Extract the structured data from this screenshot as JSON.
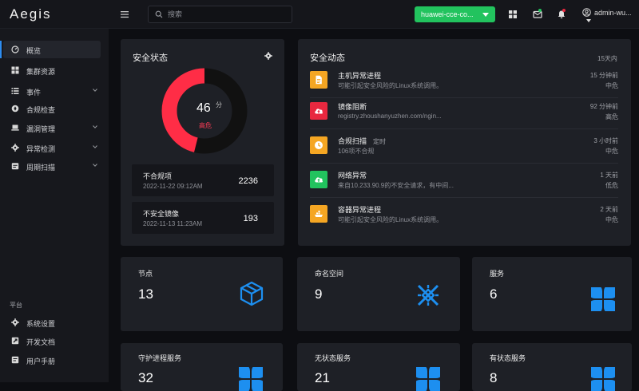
{
  "app": {
    "logo": "Aegis"
  },
  "header": {
    "search_placeholder": "搜索",
    "cluster_name": "huawei-cce-co...",
    "username": "admin-wu..."
  },
  "sidebar": {
    "items": [
      {
        "label": "概览",
        "icon": "dashboard-icon"
      },
      {
        "label": "集群资源",
        "icon": "grid-icon"
      },
      {
        "label": "事件",
        "icon": "list-icon"
      },
      {
        "label": "合规检查",
        "icon": "compass-icon"
      },
      {
        "label": "漏洞管理",
        "icon": "laptop-icon"
      },
      {
        "label": "异常检测",
        "icon": "gear-icon"
      },
      {
        "label": "周期扫描",
        "icon": "calendar-icon"
      }
    ],
    "section_label": "平台",
    "platform_items": [
      {
        "label": "系统设置",
        "icon": "settings-icon"
      },
      {
        "label": "开发文档",
        "icon": "link-icon"
      },
      {
        "label": "用户手册",
        "icon": "book-icon"
      }
    ]
  },
  "security_status": {
    "title": "安全状态",
    "score": "46",
    "score_unit": "分",
    "level": "高危",
    "score_fraction": 0.46,
    "colors": {
      "risk": "#ff2d46",
      "track": "#111111"
    },
    "items": [
      {
        "title": "不合规项",
        "date": "2022-11-22  09:12AM",
        "value": "2236"
      },
      {
        "title": "不安全镜像",
        "date": "2022-11-13  11:23AM",
        "value": "193"
      }
    ]
  },
  "security_events": {
    "title": "安全动态",
    "range": "15天内",
    "events": [
      {
        "title": "主机异常进程",
        "tag": "",
        "desc": "可能引起安全风险的Linux系统调用。",
        "time": "15 分钟前",
        "level": "中危",
        "color": "#f5a623",
        "icon": "document-icon"
      },
      {
        "title": "镜像阻断",
        "tag": "",
        "desc": "registry.zhoushanyuzhen.com/ngin...",
        "time": "92 分钟前",
        "level": "高危",
        "color": "#e8283f",
        "icon": "cloud-upload-icon"
      },
      {
        "title": "合规扫描",
        "tag": "定时",
        "desc": "106项不合规",
        "time": "3 小时前",
        "level": "中危",
        "color": "#f5a623",
        "icon": "clock-icon"
      },
      {
        "title": "网络异常",
        "tag": "",
        "desc": "来自10.233.90.9的不安全请求，有中间...",
        "time": "1 天前",
        "level": "低危",
        "color": "#22c35e",
        "icon": "cloud-upload-icon"
      },
      {
        "title": "容器异常进程",
        "tag": "",
        "desc": "可能引起安全风险的Linux系统调用。",
        "time": "2 天前",
        "level": "中危",
        "color": "#f5a623",
        "icon": "container-icon"
      }
    ]
  },
  "stats": [
    {
      "title": "节点",
      "value": "13",
      "icon": "cube-icon"
    },
    {
      "title": "命名空间",
      "value": "9",
      "icon": "namespace-icon"
    },
    {
      "title": "服务",
      "value": "6",
      "icon": "petals-icon"
    },
    {
      "title": "守护进程服务",
      "value": "32",
      "icon": "petals-icon"
    },
    {
      "title": "无状态服务",
      "value": "21",
      "icon": "petals-icon"
    },
    {
      "title": "有状态服务",
      "value": "8",
      "icon": "petals-icon"
    }
  ],
  "accent_color": "#1d8ff0"
}
